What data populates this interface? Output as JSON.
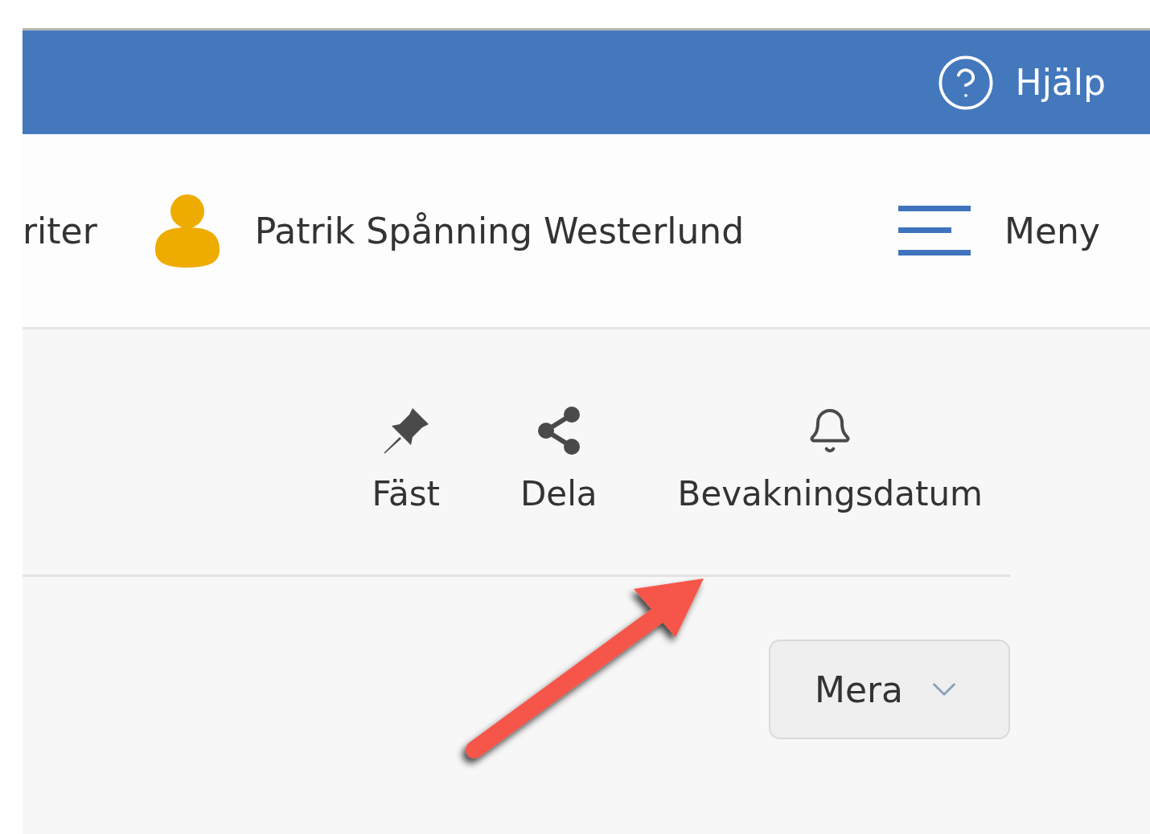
{
  "header": {
    "help_label": "Hjälp"
  },
  "user_bar": {
    "favorites_label": "riter",
    "user_name": "Patrik Spånning Westerlund",
    "menu_label": "Meny"
  },
  "toolbar": [
    {
      "kind": "pin",
      "label": "Fäst"
    },
    {
      "kind": "share",
      "label": "Dela"
    },
    {
      "kind": "bell",
      "label": "Bevakningsdatum"
    }
  ],
  "more_button": {
    "label": "Mera"
  }
}
